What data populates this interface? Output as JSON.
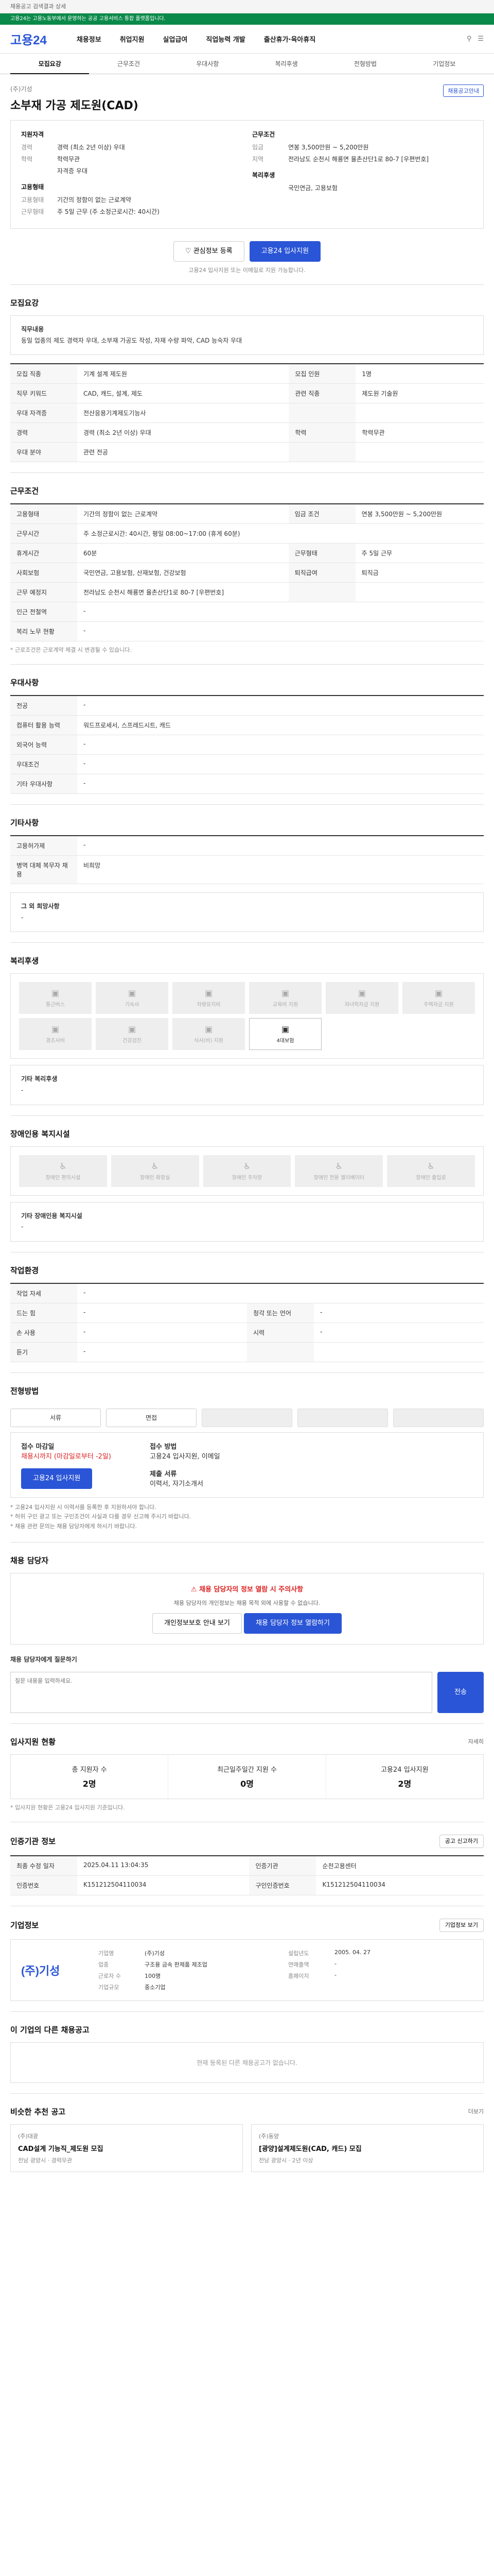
{
  "topbar": {
    "text": "채용공고 검색결과 상세"
  },
  "greenbar": {
    "text": "고용24는 고용노동부에서 운영하는 공공 고용서비스 통합 플랫폼입니다."
  },
  "header": {
    "logo": "고용24",
    "nav": [
      "채용정보",
      "취업지원",
      "실업급여",
      "직업능력 개발",
      "출산휴가·육아휴직"
    ]
  },
  "tabs": [
    "모집요강",
    "근무조건",
    "우대사항",
    "복리후생",
    "전형방법",
    "기업정보"
  ],
  "job": {
    "company": "(주)기성",
    "title": "소부재 가공 제도원(CAD)",
    "badge": "채용공고안내",
    "left_title": "지원자격",
    "left": [
      {
        "k": "경력",
        "v": "경력 (최소 2년 이상) 우대"
      },
      {
        "k": "학력",
        "v": "학력무관"
      },
      {
        "k": "",
        "v": "자격증 우대"
      }
    ],
    "left2_title": "고용형태",
    "left2": [
      {
        "k": "고용형태",
        "v": "기간의 정함이 없는 근로계약"
      },
      {
        "k": "근무형태",
        "v": "주 5일 근무 (주 소정근로시간: 40시간)"
      }
    ],
    "right_title": "근무조건",
    "right": [
      {
        "k": "임금",
        "v": "연봉 3,500만원 ~ 5,200만원"
      },
      {
        "k": "지역",
        "v": "전라남도 순천시 해룡면 율촌산단1로 80-7 [우편번호]"
      }
    ],
    "right2_title": "복리후생",
    "right2": [
      {
        "k": "",
        "v": "국민연금, 고용보험"
      }
    ],
    "btn_bookmark": "관심정보 등록",
    "btn_apply": "고용24 입사지원",
    "note": "고용24 입사지원 또는 이메일로 지원 가능합니다."
  },
  "recruit": {
    "title": "모집요강",
    "duty_title": "직무내용",
    "duty": "동일 업종의 제도 경력자 우대, 소부재 가공도 작성, 자재 수량 파악, CAD 능숙자 우대",
    "rows": [
      {
        "k": "모집 직종",
        "v": "기계 설계 제도원",
        "k2": "모집 인원",
        "v2": "1명"
      },
      {
        "k": "직무 키워드",
        "v": "CAD, 캐드, 설계, 제도",
        "k2": "관련 직종",
        "v2": "제도원 기술원"
      },
      {
        "k": "우대 자격증",
        "v": "전산응용기계제도기능사",
        "k2": "",
        "v2": ""
      },
      {
        "k": "경력",
        "v": "경력 (최소 2년 이상) 우대",
        "k2": "학력",
        "v2": "학력무관"
      },
      {
        "k": "우대 분야",
        "v": "관련 전공",
        "k2": "",
        "v2": ""
      }
    ]
  },
  "work": {
    "title": "근무조건",
    "rows": [
      {
        "k": "고용형태",
        "v": "기간의 정함이 없는 근로계약",
        "k2": "임금 조건",
        "v2": "연봉 3,500만원 ~ 5,200만원"
      },
      {
        "k": "근무시간",
        "v": "주 소정근로시간: 40시간, 평일 08:00~17:00 (휴게 60분)"
      },
      {
        "k": "휴게시간",
        "v": "60분",
        "k2": "근무형태",
        "v2": "주 5일 근무"
      },
      {
        "k": "사회보험",
        "v": "국민연금, 고용보험, 산재보험, 건강보험",
        "k2": "퇴직급여",
        "v2": "퇴직금"
      },
      {
        "k": "근무 예정지",
        "v": "전라남도 순천시 해룡면 율촌산단1로 80-7 [우편번호]",
        "k2": "",
        "v2": ""
      },
      {
        "k": "인근 전철역",
        "v": "-"
      },
      {
        "k": "복리 노무 현황",
        "v": "-"
      }
    ],
    "footnote": "* 근로조건은 근로계약 체결 시 변경될 수 있습니다."
  },
  "prefer": {
    "title": "우대사항",
    "rows": [
      {
        "k": "전공",
        "v": "-"
      },
      {
        "k": "컴퓨터 활용 능력",
        "v": "워드프로세서, 스프레드시트, 캐드"
      },
      {
        "k": "외국어 능력",
        "v": "-"
      },
      {
        "k": "우대조건",
        "v": "-"
      },
      {
        "k": "기타 우대사항",
        "v": "-"
      }
    ]
  },
  "career": {
    "title": "기타사항",
    "rows": [
      {
        "k": "고용허가제",
        "v": "-"
      },
      {
        "k": "병역 대체 복무자 채용",
        "v": "비희망"
      }
    ]
  },
  "other": {
    "title": "그 외 희망사항",
    "v": "-"
  },
  "welfare": {
    "title": "복리후생",
    "items": [
      "통근버스",
      "기숙사",
      "차량유지비",
      "교육비 지원",
      "자녀학자금 지원",
      "주택자금 지원",
      "경조사비",
      "건강검진",
      "식사(비) 지원",
      "4대보험"
    ],
    "on": [
      9
    ],
    "etc_title": "기타 복리후생",
    "etc": "-"
  },
  "disability": {
    "title": "장애인용 복지시설",
    "items": [
      "장애인 편의시설",
      "장애인 화장실",
      "장애인 주차장",
      "장애인 전용 엘리베이터",
      "장애인 출입로"
    ],
    "etc_title": "기타 장애인용 복지시설",
    "etc": "-"
  },
  "workenv": {
    "title": "작업환경",
    "rows": [
      {
        "k": "작업 자세",
        "v": "-"
      },
      {
        "k": "드는 힘",
        "v": "-",
        "k2": "청각 또는 언어",
        "v2": "-"
      },
      {
        "k": "손 사용",
        "v": "-",
        "k2": "시력",
        "v2": "-"
      },
      {
        "k": "듣기",
        "v": "-",
        "k2": "",
        "v2": ""
      }
    ]
  },
  "process": {
    "title": "전형방법",
    "steps": [
      "서류",
      "면접",
      "",
      "",
      ""
    ],
    "apply_title": "접수 마감일",
    "apply_deadline": "채용시까지 (마감일로부터 -2일)",
    "method_title": "접수 방법",
    "method": "고용24 입사지원, 이메일",
    "docs_title": "제출 서류",
    "docs": "이력서, 자기소개서",
    "apply_btn": "고용24 입사지원",
    "notes": [
      "* 고용24 입사지원 시 이력서를 등록한 후 지원하셔야 합니다.",
      "* 허위 구인 광고 또는 구인조건이 사실과 다를 경우 신고해 주시기 바랍니다.",
      "* 채용 관련 문의는 채용 담당자에게 하시기 바랍니다."
    ]
  },
  "contact": {
    "title": "채용 담당자",
    "alert": "채용 담당자의 정보 열람 시 주의사항",
    "desc": "채용 담당자의 개인정보는 채용 목적 외에 사용할 수 없습니다.",
    "btn1": "개인정보보호 안내 보기",
    "btn2": "채용 담당자 정보 열람하기",
    "q_title": "채용 담당자에게 질문하기",
    "q_placeholder": "질문 내용을 입력하세요.",
    "q_btn": "전송"
  },
  "apply_stats": {
    "title": "입사지원 현황",
    "more": "자세히",
    "items": [
      {
        "k": "총 지원자 수",
        "v": "2명"
      },
      {
        "k": "최근일주일간 지원 수",
        "v": "0명"
      },
      {
        "k": "고용24 입사지원",
        "v": "2명"
      }
    ],
    "note": "* 입사지원 현황은 고용24 입사지원 기준입니다."
  },
  "meta": {
    "title": "인증기관 정보",
    "btn": "공고 신고하기",
    "rows": [
      {
        "k": "최종 수정 일자",
        "v": "2025.04.11 13:04:35",
        "k2": "인증기관",
        "v2": "순천고용센터"
      },
      {
        "k": "인증번호",
        "v": "K151212504110034",
        "k2": "구인인증번호",
        "v2": "K151212504110034"
      }
    ]
  },
  "company": {
    "title": "기업정보",
    "logo": "(주)기성",
    "rows": [
      {
        "k": "기업명",
        "v": "(주)기성",
        "k2": "설립년도",
        "v2": "2005. 04. 27"
      },
      {
        "k": "업종",
        "v": "구조용 금속 판제품 제조업",
        "k2": "연매출액",
        "v2": "-"
      },
      {
        "k": "근로자 수",
        "v": "100명",
        "k2": "홈페이지",
        "v2": "-"
      },
      {
        "k": "기업규모",
        "v": "중소기업",
        "k2": "",
        "v2": ""
      }
    ],
    "btn": "기업정보 보기"
  },
  "related": {
    "title": "이 기업의 다른 채용공고",
    "empty": "현재 등록된 다른 채용공고가 없습니다."
  },
  "similar": {
    "title": "비슷한 추천 공고",
    "more": "더보기",
    "cards": [
      {
        "co": "(주)대광",
        "t": "CAD설계 기능직_제도원 모집",
        "m": "전남 광양시 · 경력무관"
      },
      {
        "co": "(주)동양",
        "t": "[광양]설계제도원(CAD, 캐드) 모집",
        "m": "전남 광양시 · 2년 이상"
      }
    ]
  }
}
